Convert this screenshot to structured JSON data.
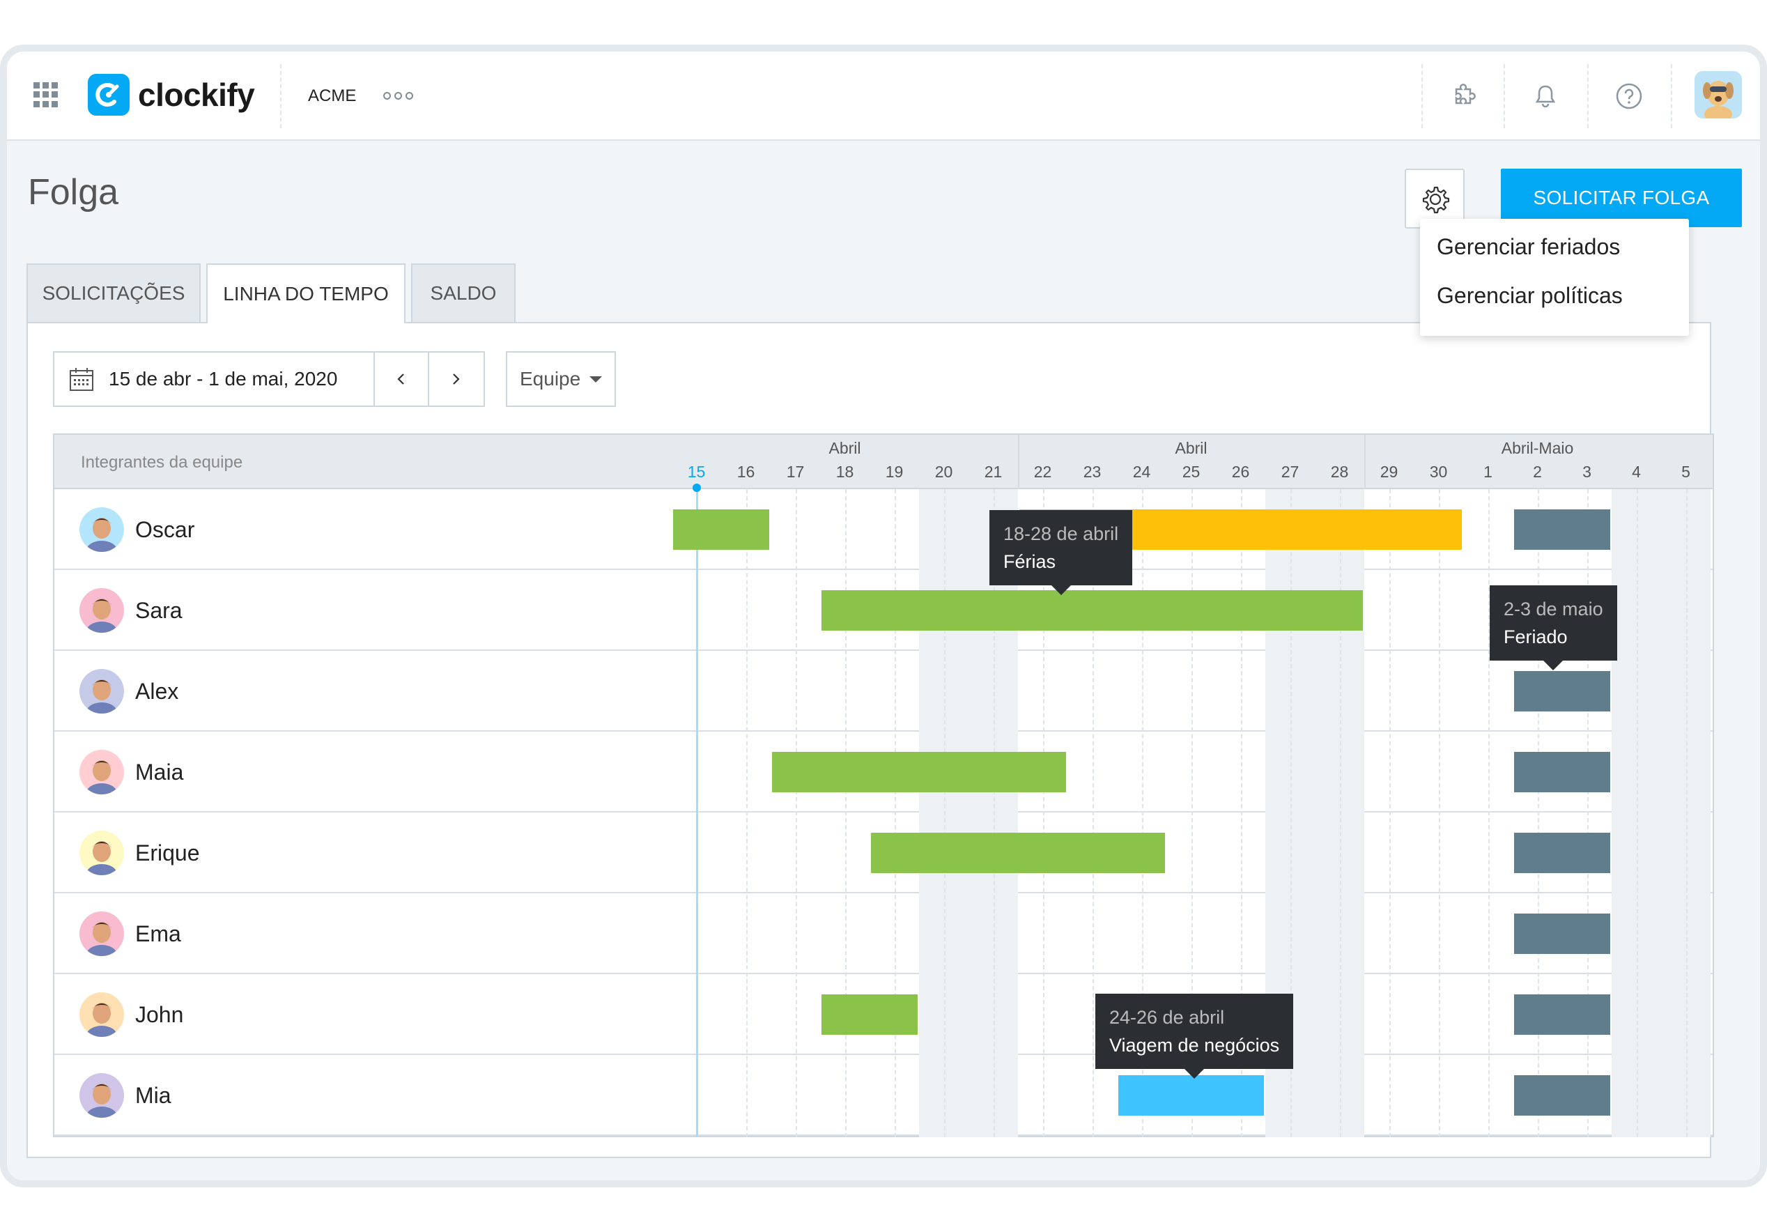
{
  "app": {
    "brand": "clockify",
    "workspace": "ACME",
    "colors": {
      "accent": "#03a9f4",
      "vacation": "#8bc34a",
      "vacation_alt": "#ffc107",
      "holiday": "#607d8b",
      "trip": "#40c4ff"
    }
  },
  "header_icons": [
    "puzzle-icon",
    "bell-icon",
    "help-icon"
  ],
  "page": {
    "title": "Folga",
    "primary_button": "SOLICITAR FOLGA"
  },
  "settings_menu": {
    "items": [
      "Gerenciar feriados",
      "Gerenciar políticas"
    ]
  },
  "tabs": [
    {
      "label": "SOLICITAÇÕES",
      "active": false
    },
    {
      "label": "LINHA DO TEMPO",
      "active": true
    },
    {
      "label": "SALDO",
      "active": false
    }
  ],
  "toolbar": {
    "date_range": "15 de abr - 1 de mai, 2020",
    "filter": "Equipe"
  },
  "timeline": {
    "members_label": "Integrantes da equipe",
    "months": [
      {
        "label": "Abril",
        "start": 0,
        "end": 7
      },
      {
        "label": "Abril",
        "start": 7,
        "end": 14
      },
      {
        "label": "Abril-Maio",
        "start": 14,
        "end": 21
      }
    ],
    "days": [
      "15",
      "16",
      "17",
      "18",
      "19",
      "20",
      "21",
      "22",
      "23",
      "24",
      "25",
      "26",
      "27",
      "28",
      "29",
      "30",
      "1",
      "2",
      "3",
      "4",
      "5"
    ],
    "today_index": 0,
    "weekend_indices": [
      5,
      6,
      12,
      13,
      19,
      20
    ],
    "members": [
      {
        "name": "Oscar",
        "avatar_color": "#b3e5fc"
      },
      {
        "name": "Sara",
        "avatar_color": "#f8bbd0"
      },
      {
        "name": "Alex",
        "avatar_color": "#c5cae9"
      },
      {
        "name": "Maia",
        "avatar_color": "#ffcdd2"
      },
      {
        "name": "Erique",
        "avatar_color": "#fff9c4"
      },
      {
        "name": "Ema",
        "avatar_color": "#f8bbd0"
      },
      {
        "name": "John",
        "avatar_color": "#ffe0b2"
      },
      {
        "name": "Mia",
        "avatar_color": "#d1c4e9"
      }
    ],
    "bars": [
      {
        "row": 0,
        "start": 0,
        "end": 2,
        "type": "vacation"
      },
      {
        "row": 0,
        "start": 7,
        "end": 16,
        "type": "vacation_alt"
      },
      {
        "row": 0,
        "start": 17,
        "end": 19,
        "type": "holiday"
      },
      {
        "row": 1,
        "start": 3,
        "end": 14,
        "type": "vacation"
      },
      {
        "row": 1,
        "start": 17,
        "end": 19,
        "type": "holiday"
      },
      {
        "row": 2,
        "start": 17,
        "end": 19,
        "type": "holiday"
      },
      {
        "row": 3,
        "start": 2,
        "end": 8,
        "type": "vacation"
      },
      {
        "row": 3,
        "start": 17,
        "end": 19,
        "type": "holiday"
      },
      {
        "row": 4,
        "start": 4,
        "end": 10,
        "type": "vacation"
      },
      {
        "row": 4,
        "start": 17,
        "end": 19,
        "type": "holiday"
      },
      {
        "row": 5,
        "start": 17,
        "end": 19,
        "type": "holiday"
      },
      {
        "row": 6,
        "start": 3,
        "end": 5,
        "type": "vacation"
      },
      {
        "row": 6,
        "start": 17,
        "end": 19,
        "type": "holiday"
      },
      {
        "row": 7,
        "start": 9,
        "end": 12,
        "type": "trip"
      },
      {
        "row": 7,
        "start": 17,
        "end": 19,
        "type": "holiday"
      }
    ],
    "tooltips": [
      {
        "dates": "18-28 de abril",
        "label": "Férias"
      },
      {
        "dates": "2-3 de maio",
        "label": "Feriado"
      },
      {
        "dates": "24-26 de abril",
        "label": "Viagem de negócios"
      }
    ]
  }
}
